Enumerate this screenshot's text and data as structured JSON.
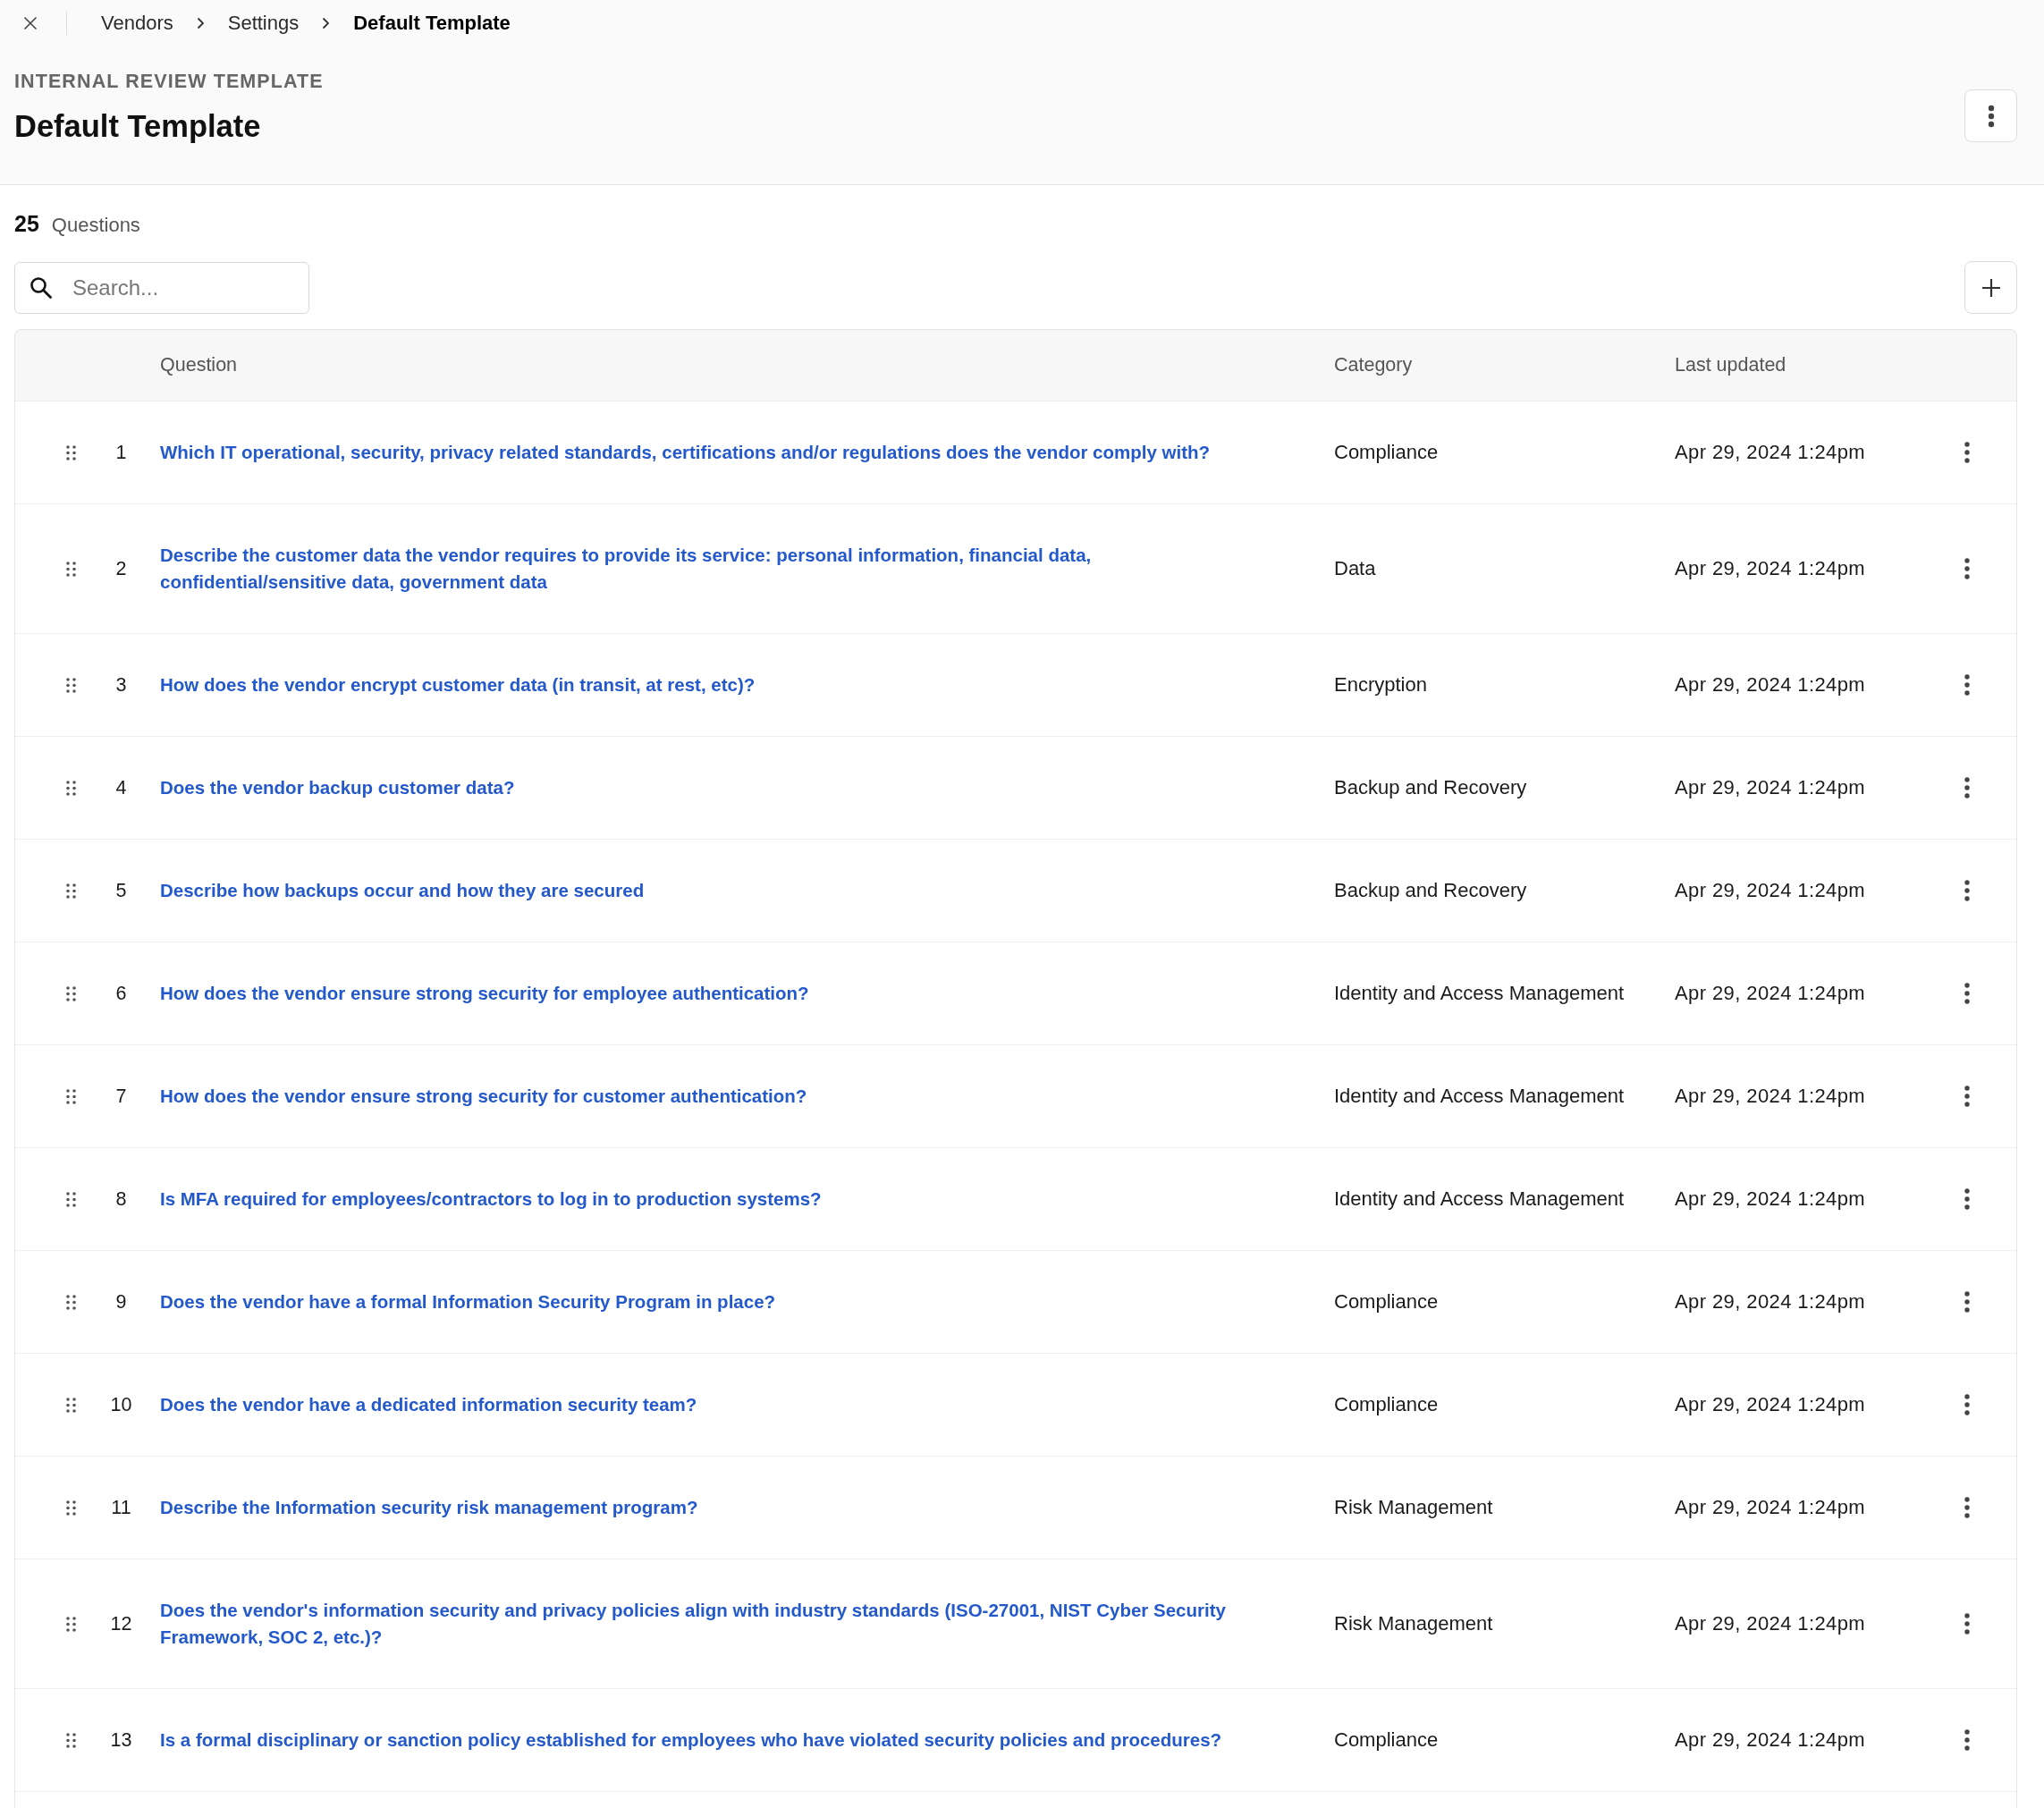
{
  "breadcrumb": [
    {
      "label": "Vendors",
      "current": false
    },
    {
      "label": "Settings",
      "current": false
    },
    {
      "label": "Default Template",
      "current": true
    }
  ],
  "header": {
    "eyebrow": "INTERNAL REVIEW TEMPLATE",
    "title": "Default Template"
  },
  "summary": {
    "count": "25",
    "label": "Questions"
  },
  "search": {
    "placeholder": "Search..."
  },
  "table": {
    "columns": [
      "Question",
      "Category",
      "Last updated"
    ],
    "rows": [
      {
        "number": "1",
        "question": "Which IT operational, security, privacy related standards, certifications and/or regulations does the vendor comply with?",
        "category": "Compliance",
        "last_updated": "Apr 29, 2024 1:24pm"
      },
      {
        "number": "2",
        "question": "Describe the customer data the vendor requires to provide its service: personal information, financial data, confidential/sensitive data, government data",
        "category": "Data",
        "last_updated": "Apr 29, 2024 1:24pm"
      },
      {
        "number": "3",
        "question": "How does the vendor encrypt customer data (in transit, at rest, etc)?",
        "category": "Encryption",
        "last_updated": "Apr 29, 2024 1:24pm"
      },
      {
        "number": "4",
        "question": "Does the vendor backup customer data?",
        "category": "Backup and Recovery",
        "last_updated": "Apr 29, 2024 1:24pm"
      },
      {
        "number": "5",
        "question": "Describe how backups occur and how they are secured",
        "category": "Backup and Recovery",
        "last_updated": "Apr 29, 2024 1:24pm"
      },
      {
        "number": "6",
        "question": "How does the vendor ensure strong security for employee authentication?",
        "category": "Identity and Access Management",
        "last_updated": "Apr 29, 2024 1:24pm"
      },
      {
        "number": "7",
        "question": "How does the vendor ensure strong security for customer authentication?",
        "category": "Identity and Access Management",
        "last_updated": "Apr 29, 2024 1:24pm"
      },
      {
        "number": "8",
        "question": "Is MFA required for employees/contractors to log in to production systems?",
        "category": "Identity and Access Management",
        "last_updated": "Apr 29, 2024 1:24pm"
      },
      {
        "number": "9",
        "question": "Does the vendor have a formal Information Security Program in place?",
        "category": "Compliance",
        "last_updated": "Apr 29, 2024 1:24pm"
      },
      {
        "number": "10",
        "question": "Does the vendor have a dedicated information security team?",
        "category": "Compliance",
        "last_updated": "Apr 29, 2024 1:24pm"
      },
      {
        "number": "11",
        "question": "Describe the Information security risk management program?",
        "category": "Risk Management",
        "last_updated": "Apr 29, 2024 1:24pm"
      },
      {
        "number": "12",
        "question": "Does the vendor's information security and privacy policies align with industry standards (ISO-27001, NIST Cyber Security Framework, SOC 2, etc.)?",
        "category": "Risk Management",
        "last_updated": "Apr 29, 2024 1:24pm"
      },
      {
        "number": "13",
        "question": "Is a formal disciplinary or sanction policy established for employees who have violated security policies and procedures?",
        "category": "Compliance",
        "last_updated": "Apr 29, 2024 1:24pm"
      }
    ]
  }
}
